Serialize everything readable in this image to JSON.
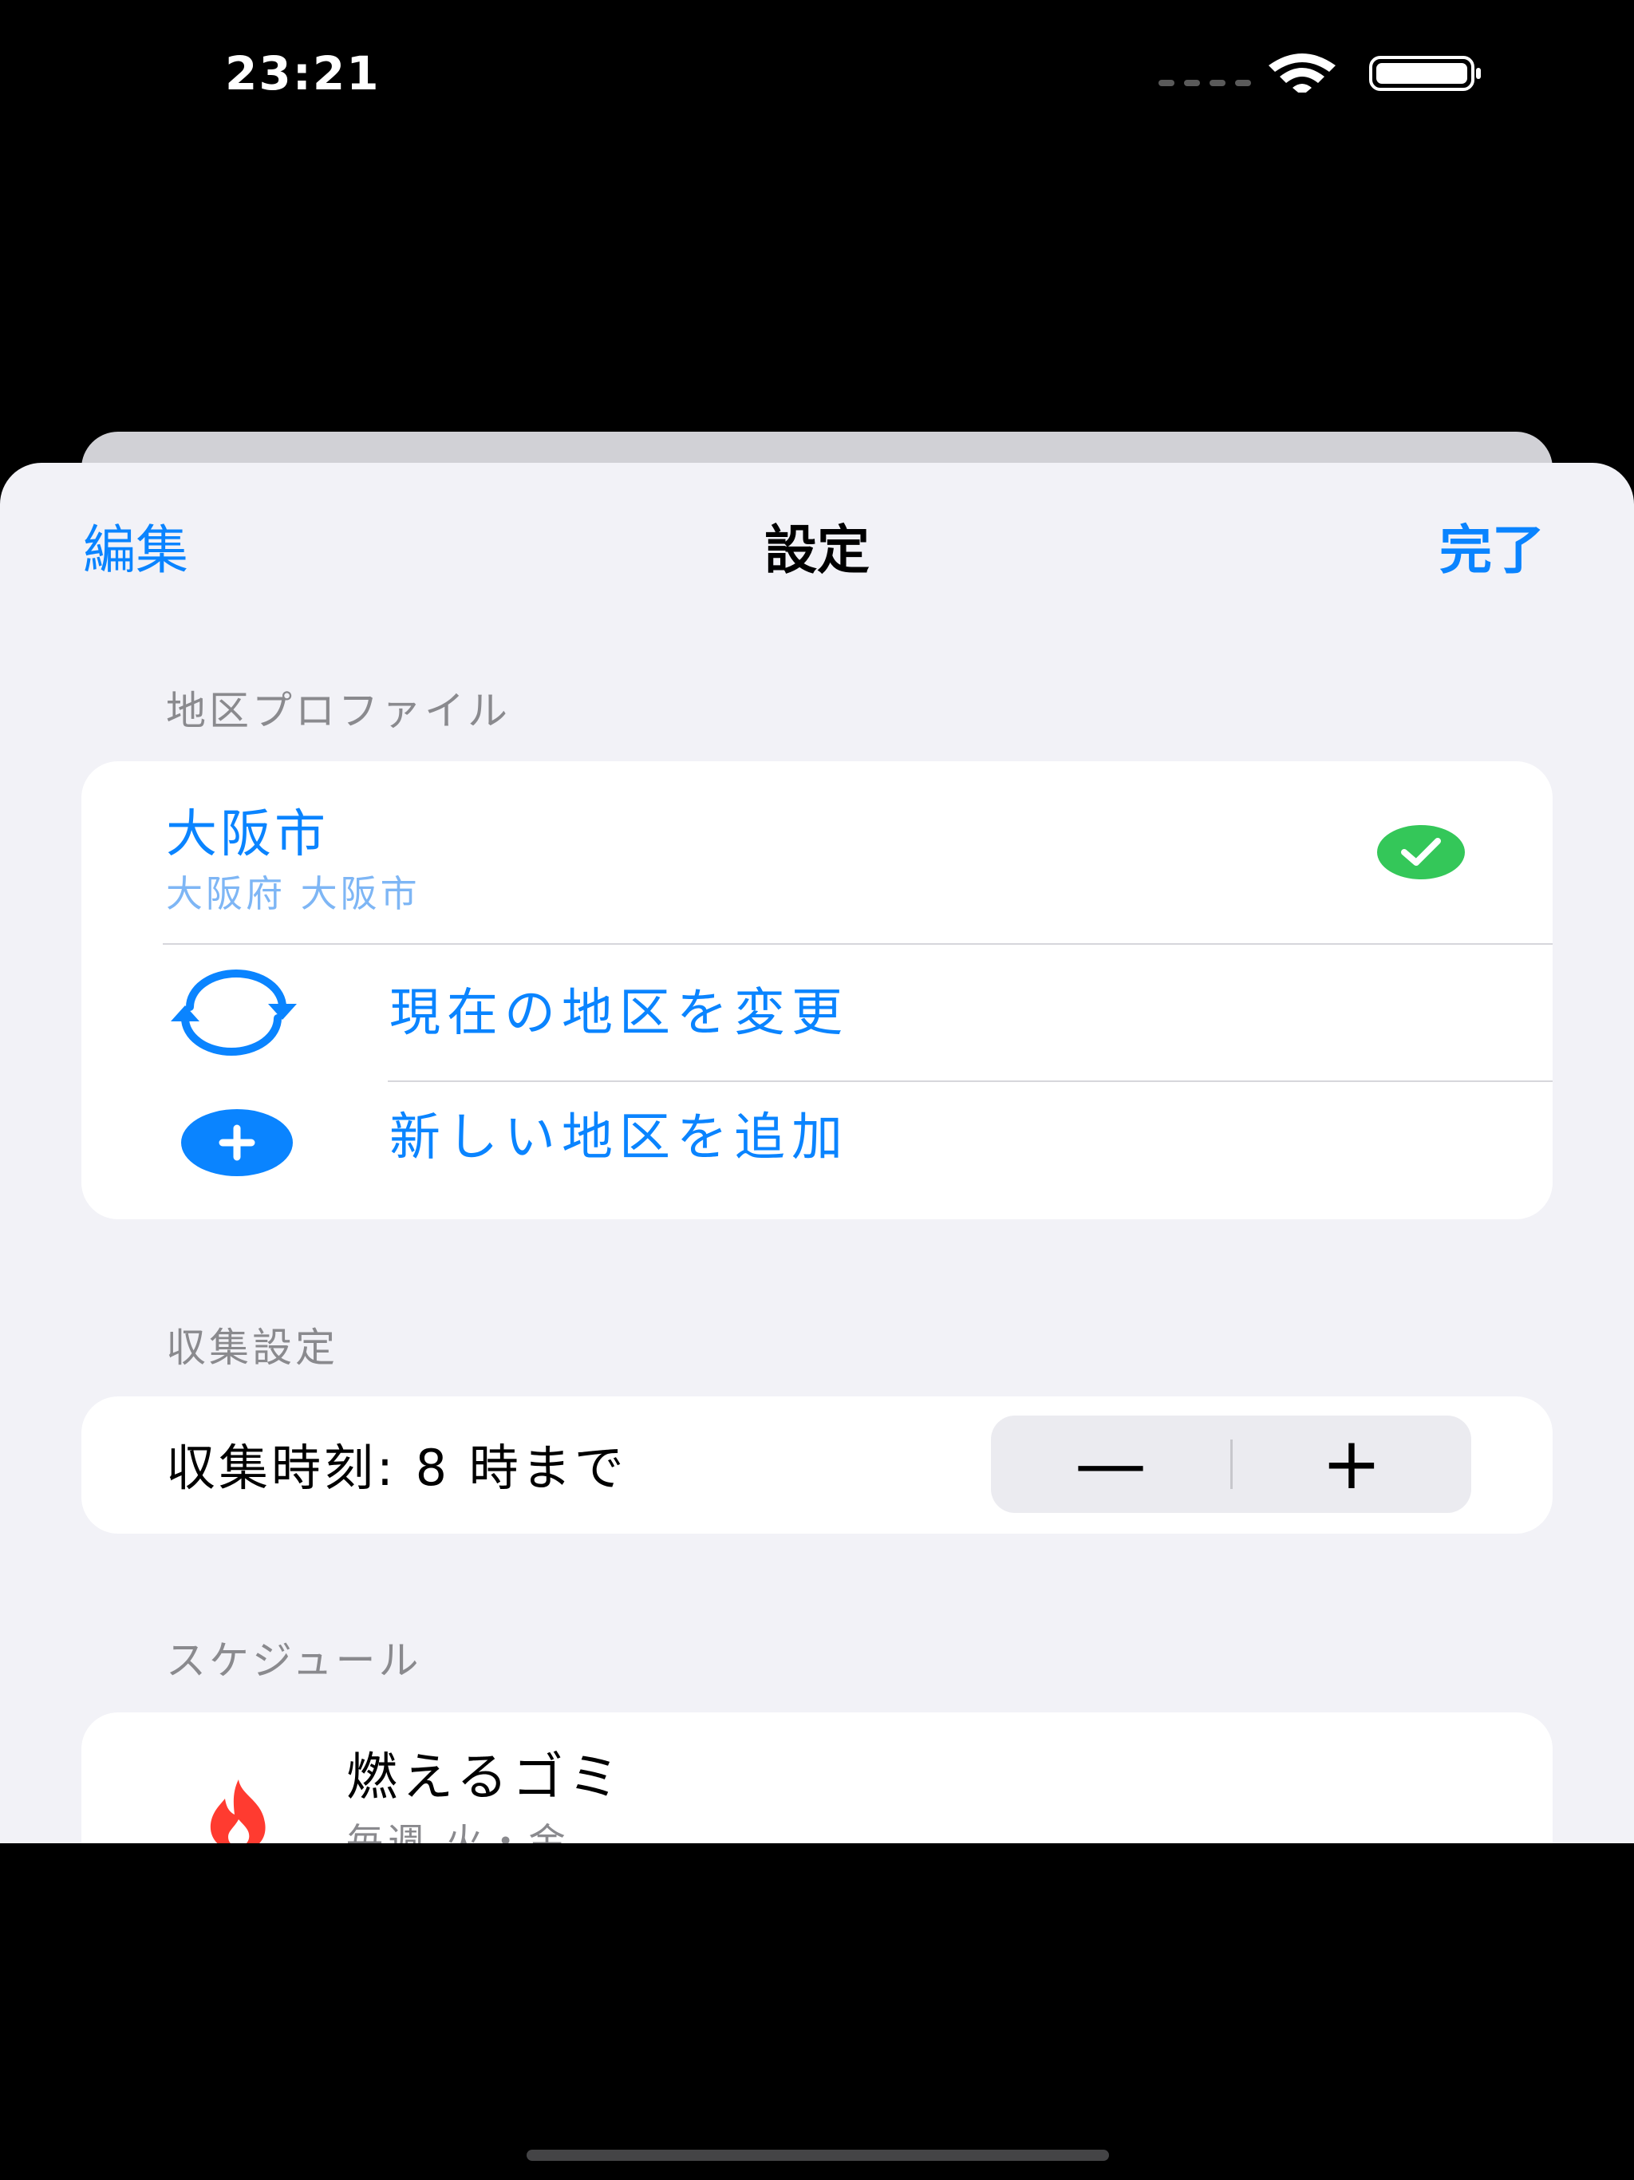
{
  "status_bar": {
    "time": "23:21"
  },
  "nav": {
    "edit_label": "編集",
    "title": "設定",
    "done_label": "完了"
  },
  "sections": {
    "profile": {
      "header": "地区プロファイル",
      "current": {
        "name": "大阪市",
        "subtitle": "大阪府 大阪市"
      },
      "change_label": "現在の地区を変更",
      "add_label": "新しい地区を追加"
    },
    "collection": {
      "header": "収集設定",
      "time_label": "収集時刻: 8 時まで",
      "decrement_symbol": "—",
      "increment_symbol": "+"
    },
    "schedule": {
      "header": "スケジュール",
      "items": [
        {
          "title": "燃えるゴミ",
          "subtitle": "毎週 火・金",
          "icon": "flame-icon"
        }
      ]
    }
  },
  "colors": {
    "accent": "#0a84ff",
    "check_green": "#34c759",
    "flame_red": "#ff3b30",
    "sheet_background": "#f2f2f7"
  },
  "icons": [
    "wifi-icon",
    "battery-icon",
    "checkmark-circle-icon",
    "refresh-arrows-icon",
    "plus-circle-icon",
    "flame-icon"
  ]
}
